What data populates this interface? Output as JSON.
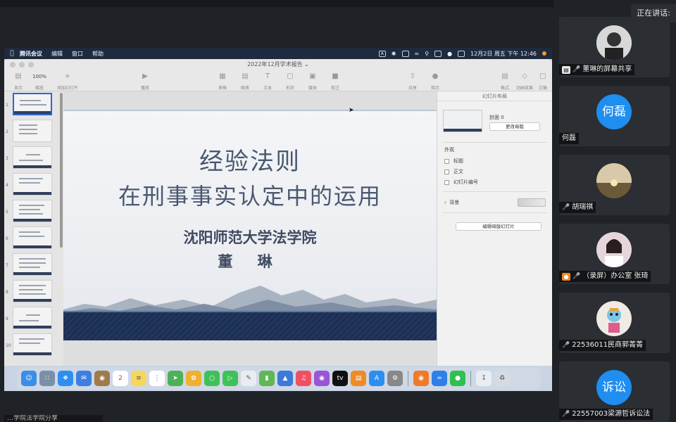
{
  "meeting": {
    "speaking_label": "正在讲话:",
    "dim_title": "",
    "bottom_status": "…学院法学院分享"
  },
  "menubar": {
    "items": [
      "腾讯会议",
      "编辑",
      "窗口",
      "帮助"
    ],
    "clock": "12月2日 周五 下午 12:46",
    "status_icons": [
      "keyboard-icon",
      "bluetooth-icon",
      "battery-icon",
      "wifi-icon",
      "search-icon",
      "screen-share-icon",
      "user-icon",
      "control-center-icon"
    ]
  },
  "keynote": {
    "window_title": "2022年12月学术报告",
    "toolbar": {
      "view": "显示",
      "zoom_value": "100%",
      "zoom": "缩放",
      "add_slide": "添加幻灯片",
      "play": "播放",
      "table": "表格",
      "chart": "图表",
      "text": "文本",
      "shape": "形状",
      "media": "媒体",
      "comment": "批注",
      "share": "共享",
      "format": "格式",
      "animate": "动画效果",
      "document": "文稿",
      "tip": "指示"
    },
    "slide_numbers": [
      "1",
      "2",
      "3",
      "4",
      "5",
      "6",
      "7",
      "8",
      "9",
      "10"
    ],
    "slide": {
      "title_line1": "经验法则",
      "title_line2": "在刑事事实认定中的运用",
      "organization": "沈阳师范大学法学院",
      "author": "董 琳"
    },
    "inspector": {
      "header": "幻灯片布局",
      "master_name": "封面 0",
      "change_master": "更改母版",
      "appearance": "外观",
      "checkbox_title": "标题",
      "checkbox_body": "正文",
      "checkbox_number": "幻灯片编号",
      "background": "背景",
      "edit_master": "编辑母版幻灯片"
    }
  },
  "dock": {
    "calendar_day": "2"
  },
  "participants": [
    {
      "name": "董琳的屏幕共享",
      "avatar_type": "photo",
      "avatar_color": "#cfcfcf",
      "indicator": "screen-share-icon",
      "muted": true
    },
    {
      "name": "何磊",
      "avatar_type": "text",
      "avatar_text": "何磊",
      "avatar_color": "#1e8ef0",
      "indicator": "",
      "muted": false
    },
    {
      "name": "胡瑞祺",
      "avatar_type": "photo",
      "avatar_color": "#c2a87a",
      "indicator": "",
      "muted": true
    },
    {
      "name": "（录屏）办公室 张琦",
      "avatar_type": "photo",
      "avatar_color": "#d9c8cf",
      "indicator": "user-icon",
      "muted": true
    },
    {
      "name": "22536011民商郭菁菁",
      "avatar_type": "photo",
      "avatar_color": "#e0dcd6",
      "indicator": "",
      "muted": true
    },
    {
      "name": "22557003梁源哲诉讼法",
      "avatar_type": "text",
      "avatar_text": "诉讼法",
      "avatar_color": "#1e8ef0",
      "indicator": "",
      "muted": true
    }
  ]
}
